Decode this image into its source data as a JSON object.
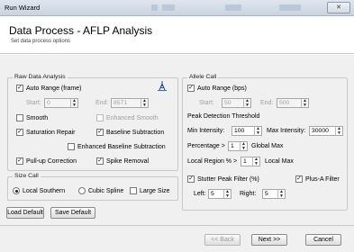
{
  "window": {
    "title": "Run Wizard",
    "close_glyph": "✕"
  },
  "header": {
    "title": "Data Process - AFLP Analysis",
    "subtitle": "Set data process options"
  },
  "raw": {
    "legend": "Raw Data Analysis",
    "auto_range": "Auto Range (frame)",
    "start_label": "Start:",
    "start_value": "0",
    "end_label": "End:",
    "end_value": "8571",
    "smooth": "Smooth",
    "enhanced_smooth": "Enhanced Smooth",
    "saturation_repair": "Saturation Repair",
    "baseline_subtraction": "Baseline Subtraction",
    "enhanced_baseline": "Enhanced Baseline Subtraction",
    "pullup": "Pull-up Correction",
    "spike": "Spike Removal",
    "range_icon": "range-select-icon"
  },
  "size": {
    "legend": "Size Call",
    "local_southern": "Local Southern",
    "cubic_spline": "Cubic Spline",
    "large_size": "Large Size"
  },
  "buttons": {
    "load_default": "Load Default",
    "save_default": "Save Default"
  },
  "allele": {
    "legend": "Allele Call",
    "auto_range": "Auto Range (bps)",
    "start_label": "Start:",
    "start_value": "50",
    "end_label": "End:",
    "end_value": "500",
    "threshold_title": "Peak Detection Threshold",
    "min_label": "Min Intensity:",
    "min_value": "100",
    "max_label": "Max Intensity:",
    "max_value": "30000",
    "pct_label": "Percentage >",
    "pct_value": "1",
    "global_max": "Global Max",
    "region_label": "Local Region % >",
    "region_value": "1",
    "local_max": "Local Max",
    "stutter": "Stutter Peak Filter (%)",
    "plusa": "Plus-A Filter",
    "left_label": "Left:",
    "left_value": "5",
    "right_label": "Right:",
    "right_value": "5"
  },
  "footer": {
    "back": "<< Back",
    "next": "Next >>",
    "cancel": "Cancel"
  }
}
